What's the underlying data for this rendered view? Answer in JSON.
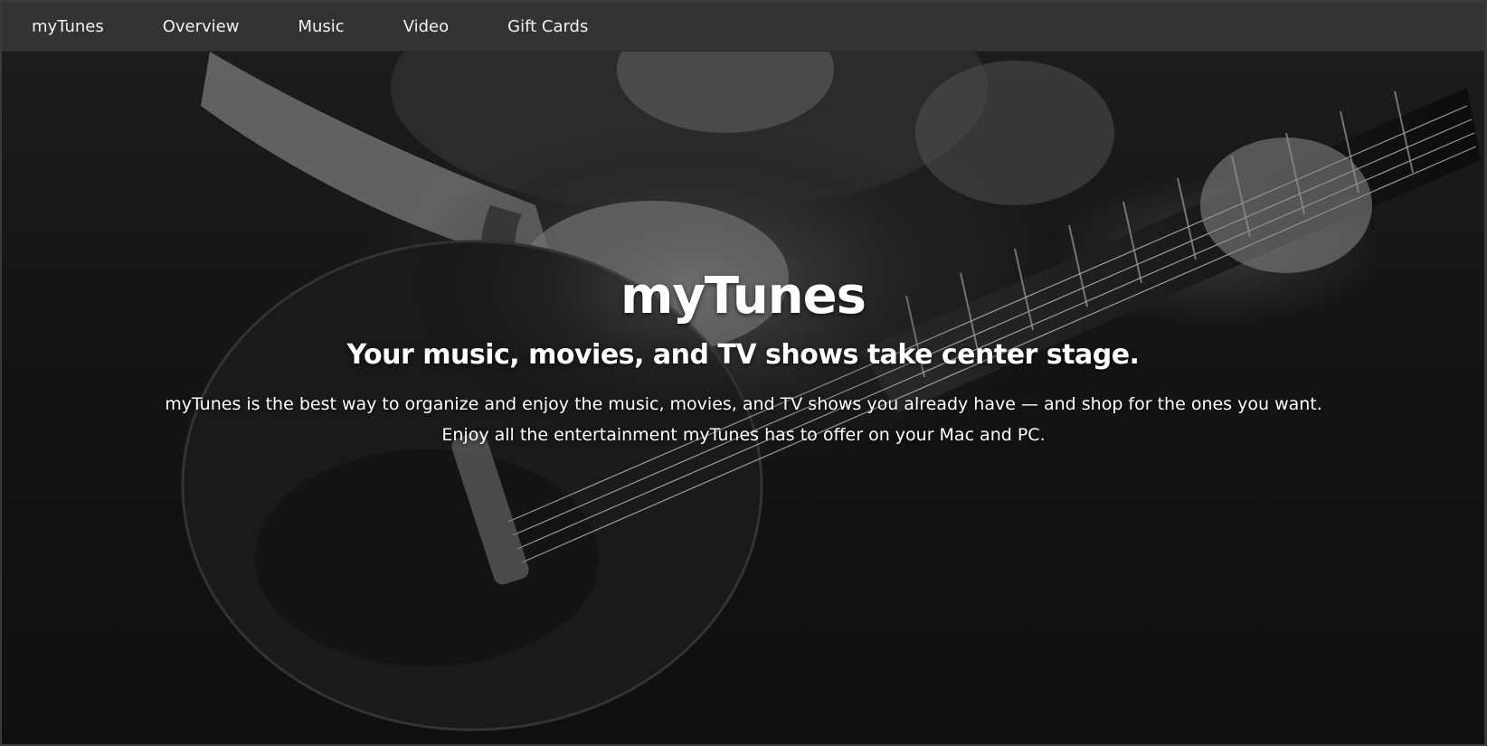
{
  "nav": {
    "brand": "myTunes",
    "links": [
      "Overview",
      "Music",
      "Video",
      "Gift Cards"
    ]
  },
  "hero": {
    "title": "myTunes",
    "subtitle": "Your music, movies, and TV shows take center stage.",
    "body": "myTunes is the best way to organize and enjoy the music, movies, and TV shows you already have — and shop for the ones you want. Enjoy all the entertainment myTunes has to offer on your Mac and PC.",
    "background_image": "black-and-white guitarist playing electric guitar"
  },
  "colors": {
    "nav_bg": "#333333",
    "nav_text": "#f2f2f2",
    "hero_bg": "#101010",
    "hero_text": "#ffffff"
  }
}
